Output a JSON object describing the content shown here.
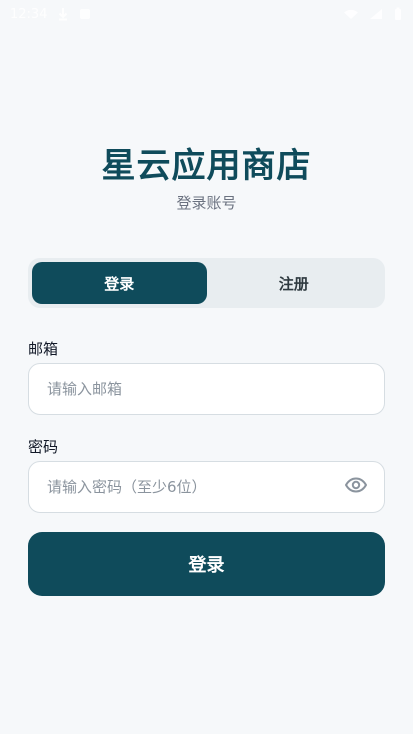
{
  "status_bar": {
    "time": "12:34",
    "left_icons": [
      "download-icon",
      "storage-icon"
    ],
    "right_icons": [
      "wifi-icon",
      "signal-icon",
      "battery-icon"
    ]
  },
  "app": {
    "title": "星云应用商店",
    "subtitle": "登录账号"
  },
  "tabs": [
    {
      "label": "登录",
      "active": true
    },
    {
      "label": "注册",
      "active": false
    }
  ],
  "form": {
    "email_label": "邮箱",
    "email_placeholder": "请输入邮箱",
    "email_value": "",
    "password_label": "密码",
    "password_placeholder": "请输入密码（至少6位）",
    "password_value": ""
  },
  "actions": {
    "submit_label": "登录"
  },
  "colors": {
    "primary": "#0f4b5b",
    "background": "#f6f8fa",
    "tab_background": "#e8edf0"
  }
}
